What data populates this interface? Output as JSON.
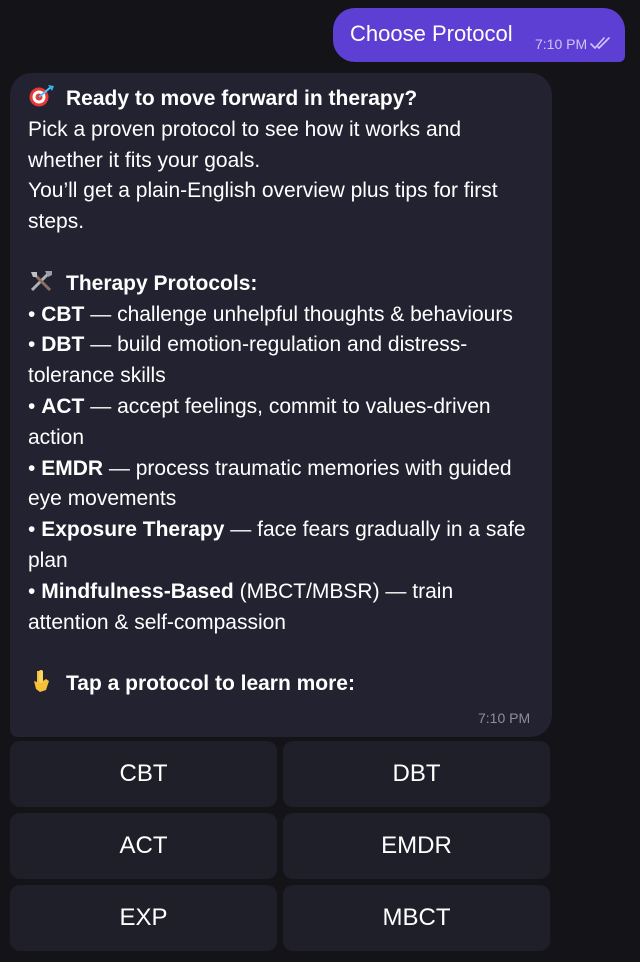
{
  "outgoing": {
    "text": "Choose Protocol",
    "time": "7:10 PM",
    "status_icon": "double-check-icon"
  },
  "incoming": {
    "heading": "Ready to move forward in therapy?",
    "heading_icon": "target-dart-emoji",
    "intro_1": "Pick a proven protocol to see how it works and whether it fits your goals.",
    "intro_2": "You’ll get a plain-English overview plus tips for first steps.",
    "protocols_heading": "Therapy Protocols:",
    "protocols_icon": "tools-emoji",
    "protocols": [
      {
        "name": "CBT",
        "desc": "challenge unhelpful thoughts & behaviours"
      },
      {
        "name": "DBT",
        "desc": "build emotion-regulation and distress-tolerance skills"
      },
      {
        "name": "ACT",
        "desc": "accept feelings, commit to values-driven action"
      },
      {
        "name": "EMDR",
        "desc": "process traumatic memories with guided eye movements"
      },
      {
        "name": "Exposure Therapy",
        "desc": "face fears gradually in a safe plan"
      },
      {
        "name": "Mindfulness-Based",
        "extra": "(MBCT/MBSR)",
        "desc": "train attention & self-compassion"
      }
    ],
    "cta": "Tap a protocol to learn more:",
    "cta_icon": "pointing-down-hand-emoji",
    "time": "7:10 PM",
    "bullet": "•",
    "dash": "—"
  },
  "keyboard": {
    "buttons": [
      "CBT",
      "DBT",
      "ACT",
      "EMDR",
      "EXP",
      "MBCT"
    ]
  },
  "colors": {
    "background": "#141418",
    "outgoing_bubble": "#5d3fd3",
    "incoming_bubble": "#232230",
    "keyboard_button": "#1e1f28"
  }
}
